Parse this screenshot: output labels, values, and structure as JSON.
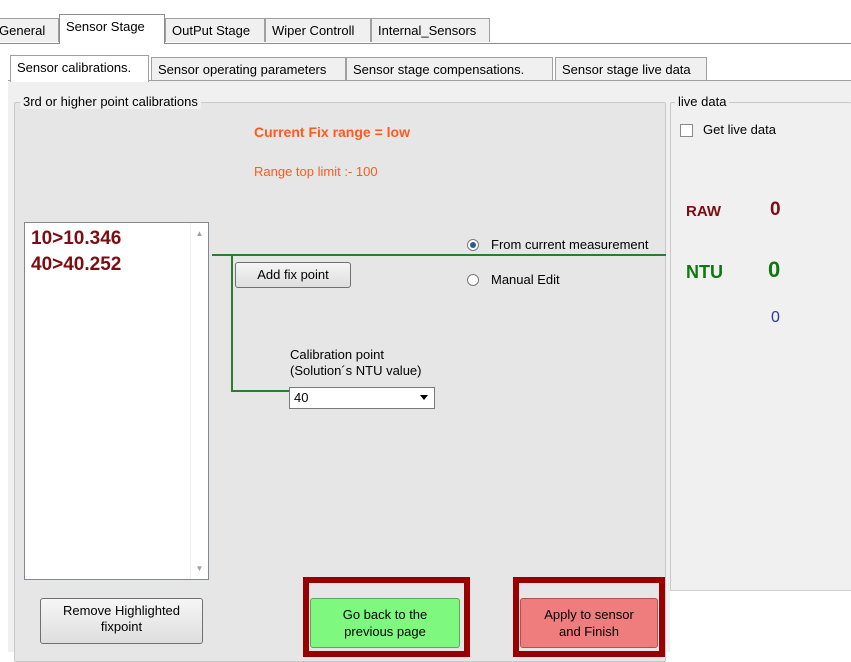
{
  "outer_tabs": [
    {
      "label": "General"
    },
    {
      "label": "Sensor Stage"
    },
    {
      "label": "OutPut Stage"
    },
    {
      "label": "Wiper Controll"
    },
    {
      "label": "Internal_Sensors"
    }
  ],
  "inner_tabs": [
    {
      "label": "Sensor calibrations."
    },
    {
      "label": "Sensor operating parameters"
    },
    {
      "label": "Sensor stage compensations."
    },
    {
      "label": "Sensor stage live data"
    }
  ],
  "calibration_group": {
    "title": "3rd or higher point calibrations",
    "current_fix_range": "Current  Fix range = low",
    "range_top_limit": "Range top limit :-   100",
    "fixpoints": [
      "10>10.346",
      "40>40.252"
    ],
    "add_fix_point_button": "Add fix point",
    "radio_from_current": "From current measurement",
    "radio_manual_edit": "Manual Edit",
    "calibration_point_label_line1": "Calibration point",
    "calibration_point_label_line2": "(Solution´s NTU value)",
    "calibration_point_value": "40",
    "remove_button_line1": "Remove Highlighted",
    "remove_button_line2": "fixpoint",
    "go_back_button_line1": "Go back to the",
    "go_back_button_line2": "previous page",
    "apply_button_line1": "Apply to sensor",
    "apply_button_line2": "and Finish"
  },
  "live_data": {
    "title": "live data",
    "get_live_data_label": "Get live data",
    "raw_label": "RAW",
    "raw_value": "0",
    "ntu_label": "NTU",
    "ntu_value": "0",
    "secondary_value": "0"
  },
  "colors": {
    "fixpoint_text": "#7b0e12",
    "range_text": "#ff5a1e",
    "ntu_green": "#0a7a0a",
    "go_back_bg": "#7ef87e",
    "apply_bg": "#f07d7d",
    "highlight_frame": "#990000"
  }
}
